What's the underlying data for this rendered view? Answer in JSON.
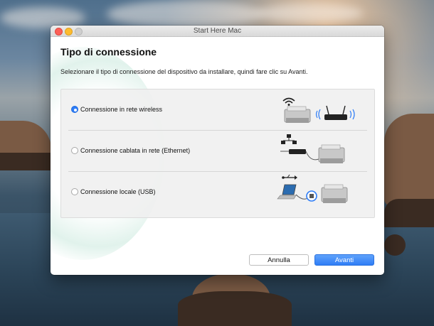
{
  "window": {
    "title": "Start Here Mac"
  },
  "page": {
    "heading": "Tipo di connessione",
    "subtitle": "Selezionare il tipo di connessione del dispositivo da installare, quindi fare clic su Avanti."
  },
  "options": [
    {
      "label": "Connessione in rete wireless",
      "selected": true,
      "illustration": "printer-wifi-router-icon"
    },
    {
      "label": "Connessione cablata in rete (Ethernet)",
      "selected": false,
      "illustration": "printer-ethernet-hub-icon"
    },
    {
      "label": "Connessione locale (USB)",
      "selected": false,
      "illustration": "laptop-usb-printer-icon"
    }
  ],
  "buttons": {
    "cancel": "Annulla",
    "next": "Avanti"
  },
  "colors": {
    "accent": "#2f7df6",
    "close": "#fc5f57",
    "minimize": "#fdbc2e"
  }
}
